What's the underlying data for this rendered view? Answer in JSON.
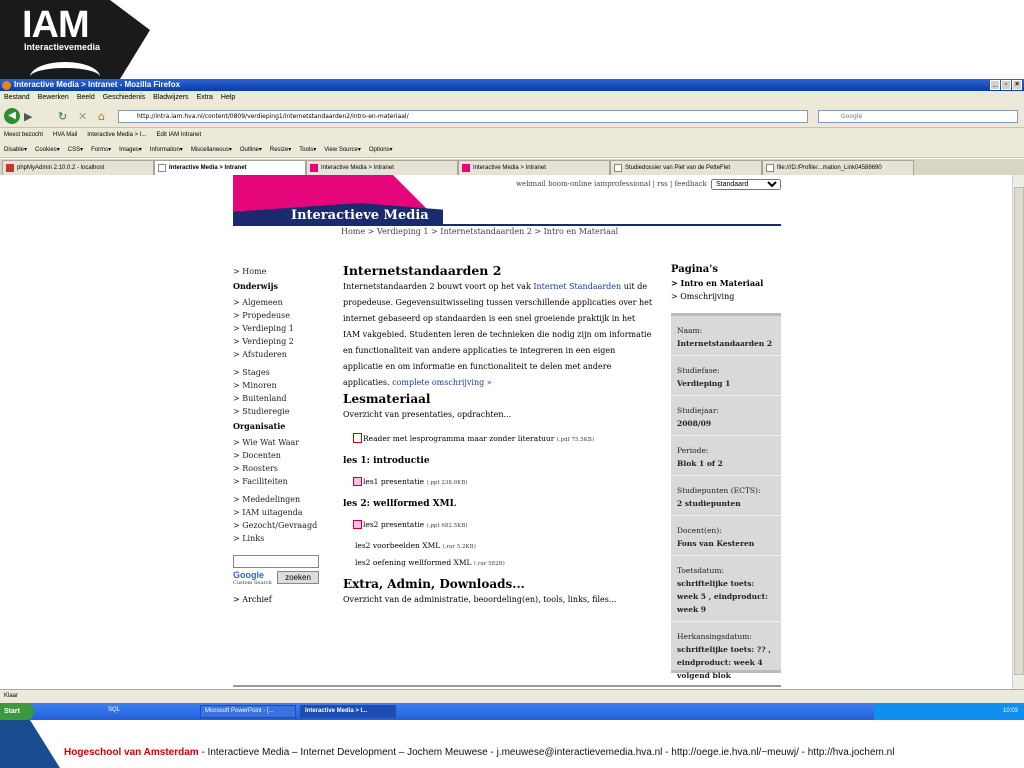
{
  "slide": {
    "logo": "IAM",
    "logo_sub": "Interactievemedia",
    "footer_org": "Hogeschool van Amsterdam",
    "footer_text": " - Interactieve Media – Internet Development – Jochem Meuwese - j.meuwese@interactievemedia.hva.nl - http://oege.ie.hva.nl/~meuwj/ - http://hva.jochem.nl"
  },
  "browser": {
    "title": "Interactive Media > Intranet - Mozilla Firefox",
    "menu": [
      "Bestand",
      "Bewerken",
      "Beeld",
      "Geschiedenis",
      "Bladwijzers",
      "Extra",
      "Help"
    ],
    "url": "http://intra.iam.hva.nl/content/0809/verdieping1/internetstandaarden2/intro-en-materiaal/",
    "search_placeholder": "Google",
    "bookmarks": [
      "Meest bezocht",
      "HVA Mail",
      "Interactive Media > I...",
      "Edit IAM Intranet"
    ],
    "devbar": [
      "Disable▾",
      "Cookies▾",
      "CSS▾",
      "Forms▾",
      "Images▾",
      "Information▾",
      "Miscellaneous▾",
      "Outline▾",
      "Resize▾",
      "Tools▾",
      "View Source▾",
      "Options▾"
    ],
    "tabs": [
      {
        "label": "phpMyAdmin 2.10.0.2 - localhost"
      },
      {
        "label": "Interactive Media > Intranet"
      },
      {
        "label": "Interactive Media > Intranet"
      },
      {
        "label": "Interactive Media > Intranet"
      },
      {
        "label": "Studiedossier van Piet van de PetteFlet"
      },
      {
        "label": "file:///D:/Profile/...mation_Link04588690"
      }
    ],
    "status": "Klaar"
  },
  "taskbar": {
    "start": "Start",
    "sql": "SQL",
    "tasks": [
      "Microsoft PowerPoint - [...",
      "Interactive Media > I..."
    ],
    "clock": "10:03"
  },
  "page": {
    "toplinks": "webmail boom-online iamprofessional  |  rss  |  feedback",
    "style_select": "Standaard",
    "site_name": "Interactieve Media",
    "breadcrumb": "Home  >  Verdieping 1  >  Internetstandaarden 2  >  Intro en Materiaal",
    "leftnav": {
      "home": "> Home",
      "onderwijs": "Onderwijs",
      "onderwijs_items": [
        "> Algemeen",
        "> Propedeuse",
        "> Verdieping 1",
        "> Verdieping 2",
        "> Afstuderen"
      ],
      "onderwijs_items2": [
        "> Stages",
        "> Minoren",
        "> Buitenland",
        "> Studieregie"
      ],
      "organisatie": "Organisatie",
      "organisatie_items": [
        "> Wie Wat Waar",
        "> Docenten",
        "> Roosters",
        "> Faciliteiten"
      ],
      "organisatie_items2": [
        "> Mededelingen",
        "> IAM uitagenda",
        "> Gezocht/Gevraagd",
        "> Links"
      ],
      "google": "Google",
      "custom_search": "Custom Search",
      "zoeken": "zoeken",
      "archief": "> Archief"
    },
    "main": {
      "title": "Internetstandaarden 2",
      "intro_a": "Internetstandaarden 2  bouwt voort op het vak ",
      "intro_link": "Internet Standaarden",
      "intro_b": " uit de propedeuse. Gegevensuitwisseling tussen verschillende applicaties over het internet gebaseerd op standaarden is een snel groeiende praktijk in het IAM vakgebied. Studenten leren de technieken die nodig zijn om informatie en functionaliteit van andere applicaties te integreren in een eigen applicatie en om informatie en functionaliteit te delen met andere applicaties. ",
      "more_link": "complete omschrijving »",
      "les_title": "Lesmateriaal",
      "les_sub": "Overzicht van presentaties, opdrachten...",
      "reader": "Reader met lesprogramma maar zonder literatuur",
      "reader_size": "(.pdf 75.5KB)",
      "les1": "les 1: introductie",
      "les1_file": "les1 presentatie",
      "les1_size": "(.ppt 238.0KB)",
      "les2": "les 2: wellformed XML",
      "les2_file": "les2 presentatie",
      "les2_size": "(.ppt 682.5KB)",
      "les2_vb": "les2 voorbeelden XML",
      "les2_vb_size": "(.rar 5.2KB)",
      "les2_oef": "les2 oefening wellformed XML",
      "les2_oef_size": "(.rar 582B)",
      "extra_title": "Extra, Admin, Downloads...",
      "extra_sub": "Overzicht van de administratie, beoordeling(en), tools, links, files..."
    },
    "sidebar": {
      "title": "Pagina's",
      "current": "> Intro en Materiaal",
      "other": "> Omschrijving",
      "meta": [
        {
          "label": "Naam:",
          "value": "Internetstandaarden 2"
        },
        {
          "label": "Studiefase:",
          "value": "Verdieping 1"
        },
        {
          "label": "Studiejaar:",
          "value": "2008/09"
        },
        {
          "label": "Periode:",
          "value": "Blok 1 of 2"
        },
        {
          "label": "Studiepunten (ECTS):",
          "value": "2 studiepunten"
        },
        {
          "label": "Docent(en):",
          "value": "Fons van Kesteren"
        },
        {
          "label": "Toetsdatum:",
          "value": "schriftelijke toets: week 5 , eindproduct: week 9"
        },
        {
          "label": "Herkansingsdatum:",
          "value": "schriftelijke toets: ?? , eindproduct: week 4 volgend blok"
        }
      ]
    }
  }
}
